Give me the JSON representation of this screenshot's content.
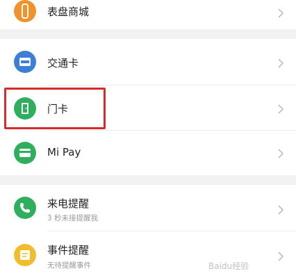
{
  "colors": {
    "orange": "#f0912b",
    "blue": "#3d7fd6",
    "green": "#2fae5e",
    "yellow": "#f2bd2c",
    "highlight": "#d62b2b"
  },
  "items": [
    {
      "label": "表盘商城",
      "icon": "watch-icon"
    },
    {
      "label": "交通卡",
      "icon": "bus-card-icon"
    },
    {
      "label": "门卡",
      "icon": "door-card-icon"
    },
    {
      "label": "Mi Pay",
      "icon": "wallet-card-icon"
    },
    {
      "label": "来电提醒",
      "subtitle": "3 秒未接提醒我",
      "icon": "phone-icon"
    },
    {
      "label": "事件提醒",
      "subtitle": "无待提醒事件",
      "icon": "event-icon"
    }
  ],
  "watermark": "Baidu经验"
}
